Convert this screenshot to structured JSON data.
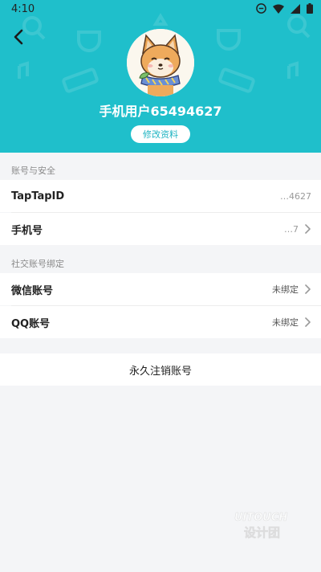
{
  "status_bar": {
    "time": "4:10",
    "icons": [
      "do-not-disturb-icon",
      "wifi-icon",
      "signal-icon",
      "battery-icon"
    ]
  },
  "header": {
    "back_icon": "arrow-left-icon",
    "username": "手机用户65494627",
    "edit_profile_label": "修改资料",
    "background_color": "#1fbfcb"
  },
  "account_security": {
    "section_title": "账号与安全",
    "rows": [
      {
        "label": "TapTapID",
        "value": "…4627"
      },
      {
        "label": "手机号",
        "value": "…7"
      }
    ]
  },
  "social_binding": {
    "section_title": "社交账号绑定",
    "rows": [
      {
        "label": "微信账号",
        "value": "未绑定"
      },
      {
        "label": "QQ账号",
        "value": "未绑定"
      }
    ]
  },
  "delete_account": {
    "label": "永久注销账号"
  },
  "watermark": {
    "text": "UITOUCH 设计团队"
  }
}
